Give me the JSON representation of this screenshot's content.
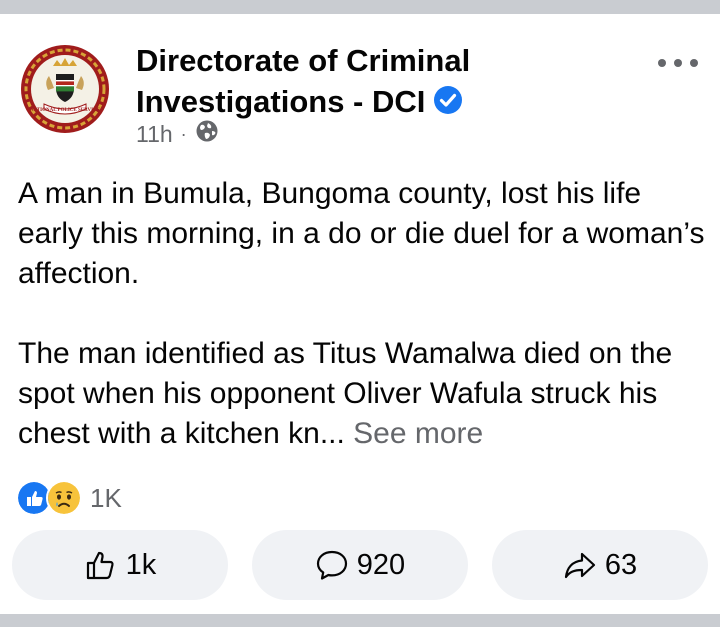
{
  "post": {
    "author": "Directorate of Criminal Investigations - DCI",
    "verified": true,
    "timestamp": "11h",
    "separator": "·",
    "audience_icon": "globe-icon",
    "menu_icon": "more-horizontal-icon",
    "paragraph_1": "A man in Bumula, Bungoma county, lost his life early this morning, in a do or die duel for a woman’s affection.",
    "paragraph_2": "The man identified as Titus Wamalwa died on the spot when his opponent Oliver Wafula struck his chest with a kitchen kn...",
    "see_more": "See more",
    "avatar_icon": "police-crest-logo",
    "avatar_text": "NATIONAL POLICE SERVICE"
  },
  "reactions": {
    "icons": [
      "like-reaction-icon",
      "sad-reaction-icon"
    ],
    "count": "1K"
  },
  "actions": {
    "like": {
      "icon": "thumbs-up-icon",
      "count": "1k"
    },
    "comment": {
      "icon": "comment-icon",
      "count": "920"
    },
    "share": {
      "icon": "share-arrow-icon",
      "count": "63"
    }
  },
  "colors": {
    "background": "#c9ccd1",
    "card": "#ffffff",
    "text": "#050505",
    "secondary_text": "#65676b",
    "verified_blue": "#1877f2",
    "button_bg": "#f0f2f5",
    "crest_red": "#a01c1c",
    "crest_gold": "#d7a437"
  }
}
